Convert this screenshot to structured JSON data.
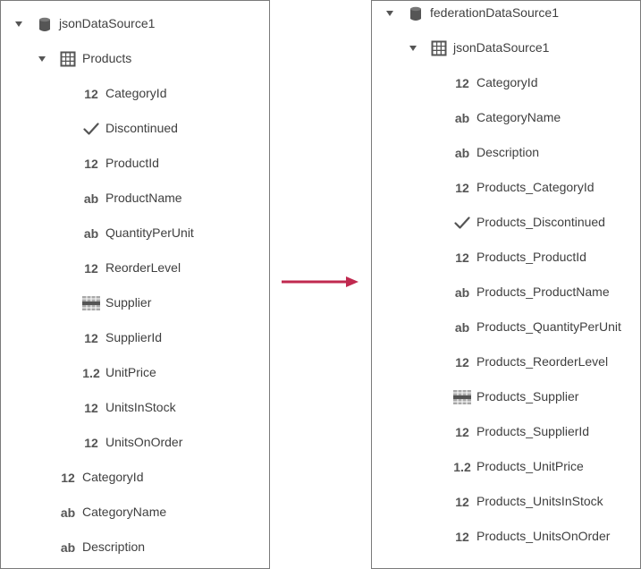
{
  "left_tree": {
    "root": {
      "label": "jsonDataSource1",
      "icon": "database-icon"
    },
    "products": {
      "label": "Products",
      "icon": "table-icon"
    },
    "fields": [
      {
        "label": "CategoryId",
        "icon": "number-icon",
        "glyph": "12"
      },
      {
        "label": "Discontinued",
        "icon": "checkmark-icon",
        "glyph": ""
      },
      {
        "label": "ProductId",
        "icon": "number-icon",
        "glyph": "12"
      },
      {
        "label": "ProductName",
        "icon": "string-icon",
        "glyph": "ab"
      },
      {
        "label": "QuantityPerUnit",
        "icon": "string-icon",
        "glyph": "ab"
      },
      {
        "label": "ReorderLevel",
        "icon": "number-icon",
        "glyph": "12"
      },
      {
        "label": "Supplier",
        "icon": "grid-icon",
        "glyph": ""
      },
      {
        "label": "SupplierId",
        "icon": "number-icon",
        "glyph": "12"
      },
      {
        "label": "UnitPrice",
        "icon": "decimal-icon",
        "glyph": "1.2"
      },
      {
        "label": "UnitsInStock",
        "icon": "number-icon",
        "glyph": "12"
      },
      {
        "label": "UnitsOnOrder",
        "icon": "number-icon",
        "glyph": "12"
      }
    ],
    "root_fields": [
      {
        "label": "CategoryId",
        "icon": "number-icon",
        "glyph": "12"
      },
      {
        "label": "CategoryName",
        "icon": "string-icon",
        "glyph": "ab"
      },
      {
        "label": "Description",
        "icon": "string-icon",
        "glyph": "ab"
      }
    ]
  },
  "right_tree": {
    "root": {
      "label": "federationDataSource1",
      "icon": "database-icon"
    },
    "child": {
      "label": "jsonDataSource1",
      "icon": "table-icon"
    },
    "fields": [
      {
        "label": "CategoryId",
        "icon": "number-icon",
        "glyph": "12"
      },
      {
        "label": "CategoryName",
        "icon": "string-icon",
        "glyph": "ab"
      },
      {
        "label": "Description",
        "icon": "string-icon",
        "glyph": "ab"
      },
      {
        "label": "Products_CategoryId",
        "icon": "number-icon",
        "glyph": "12"
      },
      {
        "label": "Products_Discontinued",
        "icon": "checkmark-icon",
        "glyph": ""
      },
      {
        "label": "Products_ProductId",
        "icon": "number-icon",
        "glyph": "12"
      },
      {
        "label": "Products_ProductName",
        "icon": "string-icon",
        "glyph": "ab"
      },
      {
        "label": "Products_QuantityPerUnit",
        "icon": "string-icon",
        "glyph": "ab"
      },
      {
        "label": "Products_ReorderLevel",
        "icon": "number-icon",
        "glyph": "12"
      },
      {
        "label": "Products_Supplier",
        "icon": "grid-icon",
        "glyph": ""
      },
      {
        "label": "Products_SupplierId",
        "icon": "number-icon",
        "glyph": "12"
      },
      {
        "label": "Products_UnitPrice",
        "icon": "decimal-icon",
        "glyph": "1.2"
      },
      {
        "label": "Products_UnitsInStock",
        "icon": "number-icon",
        "glyph": "12"
      },
      {
        "label": "Products_UnitsOnOrder",
        "icon": "number-icon",
        "glyph": "12"
      }
    ]
  },
  "colors": {
    "arrow": "#c0294f",
    "border": "#7a7a7a",
    "icon": "#555555",
    "text": "#3f3f3f"
  }
}
